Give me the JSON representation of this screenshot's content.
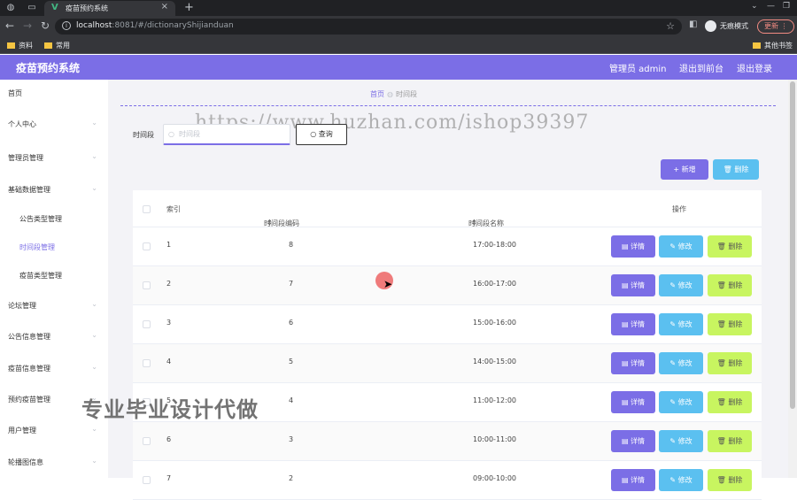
{
  "browser": {
    "tab_title": "疫苗预约系统",
    "url_host": "localhost",
    "url_rest": ":8081/#/dictionaryShijianduan",
    "incognito_label": "无痕模式",
    "update_label": "更新",
    "bookmarks": [
      "资料",
      "常用"
    ],
    "other_bookmarks": "其他书签"
  },
  "header": {
    "title": "疫苗预约系统",
    "user": "管理员 admin",
    "to_frontend": "退出到前台",
    "logout": "退出登录"
  },
  "sidebar": {
    "items": [
      {
        "label": "首页",
        "type": "top"
      },
      {
        "label": "个人中心",
        "type": "group"
      },
      {
        "label": "管理员管理",
        "type": "group"
      },
      {
        "label": "基础数据管理",
        "type": "group"
      },
      {
        "label": "公告类型管理",
        "type": "sub"
      },
      {
        "label": "时间段管理",
        "type": "sub",
        "active": true
      },
      {
        "label": "疫苗类型管理",
        "type": "sub"
      },
      {
        "label": "论坛管理",
        "type": "group"
      },
      {
        "label": "公告信息管理",
        "type": "group"
      },
      {
        "label": "疫苗信息管理",
        "type": "group"
      },
      {
        "label": "预约疫苗管理",
        "type": "group"
      },
      {
        "label": "用户管理",
        "type": "group"
      },
      {
        "label": "轮播图信息",
        "type": "group"
      }
    ]
  },
  "breadcrumb": {
    "home": "首页",
    "current": "时间段"
  },
  "watermark": "https://www.huzhan.com/ishop39397",
  "search": {
    "label": "时间段",
    "placeholder": "时间段",
    "button": "查询"
  },
  "actions": {
    "add": "新增",
    "delete": "删除"
  },
  "table": {
    "headers": {
      "index": "索引",
      "code": "时间段编码",
      "name": "时间段名称",
      "ops": "操作"
    },
    "rows": [
      {
        "index": "1",
        "code": "8",
        "name": "17:00-18:00"
      },
      {
        "index": "2",
        "code": "7",
        "name": "16:00-17:00"
      },
      {
        "index": "3",
        "code": "6",
        "name": "15:00-16:00"
      },
      {
        "index": "4",
        "code": "5",
        "name": "14:00-15:00"
      },
      {
        "index": "5",
        "code": "4",
        "name": "11:00-12:00"
      },
      {
        "index": "6",
        "code": "3",
        "name": "10:00-11:00"
      },
      {
        "index": "7",
        "code": "2",
        "name": "09:00-10:00"
      }
    ],
    "row_buttons": {
      "detail": "详情",
      "edit": "修改",
      "delete": "删除"
    }
  },
  "overlay_text": "专业毕业设计代做",
  "colors": {
    "primary": "#7b6ee6",
    "info": "#5bc0f0",
    "danger_lime": "#c8f560"
  }
}
